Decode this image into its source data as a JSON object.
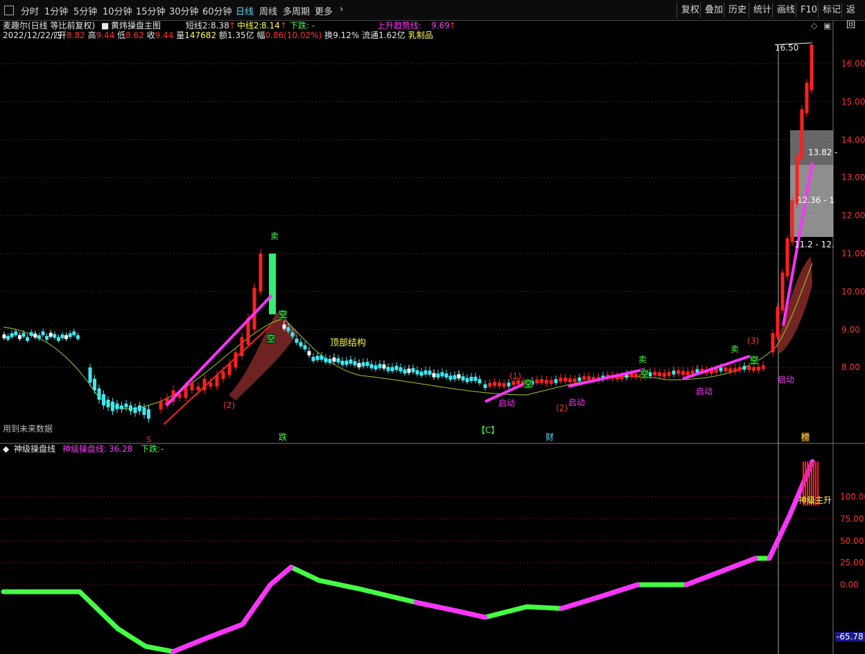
{
  "toolbar": {
    "menu_icon": "menu-icon",
    "periods": [
      "分时",
      "1分钟",
      "5分钟",
      "10分钟",
      "15分钟",
      "30分钟",
      "60分钟",
      "日线",
      "周线",
      "多周期",
      "更多"
    ],
    "active_period": "日线",
    "right_tools": [
      "复权",
      "叠加",
      "历史",
      "统计",
      "画线",
      "F10",
      "标记",
      "返回"
    ]
  },
  "main_panel": {
    "stock_title": "麦趣尔(日线 等比前复权)",
    "indicator_name": "黄炜操盘主图",
    "short_line_label": "短线2:",
    "short_line_value": "8.38",
    "mid_line_label": "中线2:",
    "mid_line_value": "8.14",
    "down_label": "下跌:",
    "down_value": "-",
    "uptrend_label": "上升趋势线:",
    "uptrend_value": "9.69",
    "date": "2022/12/22/四",
    "open_label": "开",
    "open": "8.82",
    "high_label": "高",
    "high": "9.44",
    "low_label": "低",
    "low": "8.62",
    "close_label": "收",
    "close": "9.44",
    "volume_label": "量",
    "volume": "147682",
    "amount_label": "额",
    "amount": "1.35亿",
    "change_label": "幅",
    "change": "0.86(10.02%)",
    "turnover_label": "换",
    "turnover": "9.12%",
    "float_label": "流通",
    "float_cap": "1.62亿",
    "sector": "乳制品",
    "price_axis": [
      "16.00",
      "15.00",
      "14.00",
      "13.00",
      "12.00",
      "11.00",
      "10.00",
      "9.00",
      "8.00"
    ],
    "max_price_label": "16.50",
    "annotations": {
      "top_structure": "顶部结构",
      "start_1": "启动",
      "start_2": "启动",
      "start_3": "启动",
      "start_4": "启动",
      "sell_1": "卖",
      "sell_2": "卖",
      "sell_3": "卖",
      "empty_1": "空",
      "empty_2": "空",
      "empty_3": "空",
      "empty_4": "空",
      "empty_5": "空",
      "future_data": "用到未来数据",
      "bottom_die": "跌",
      "bottom_cai": "财",
      "bottom_bang": "榜",
      "bottom_s": "S",
      "bottom_c": "【C】",
      "mark_1": "(1)",
      "mark_2": "(2)",
      "mark_3": "(3)",
      "mark_2b": "(2)",
      "box_1": "13.82 -",
      "box_2": "12.36 - 1",
      "box_3": "11.2 - 12."
    }
  },
  "sub_panel": {
    "indicator_name": "神级操盘线",
    "line_label": "神级操盘线:",
    "line_value": "36.28",
    "down_label": "下跌:",
    "down_value": "-",
    "axis": [
      "100.00",
      "75.00",
      "50.00",
      "25.00",
      "0.00"
    ],
    "current_value": "-65.78",
    "main_rise": "神级主升"
  },
  "colors": {
    "up_red": "#ff2020",
    "down_cyan": "#3ee8f0",
    "magenta": "#ff33ff",
    "green": "#44ff44",
    "yellow": "#ffff40",
    "grid": "#7a1010"
  }
}
